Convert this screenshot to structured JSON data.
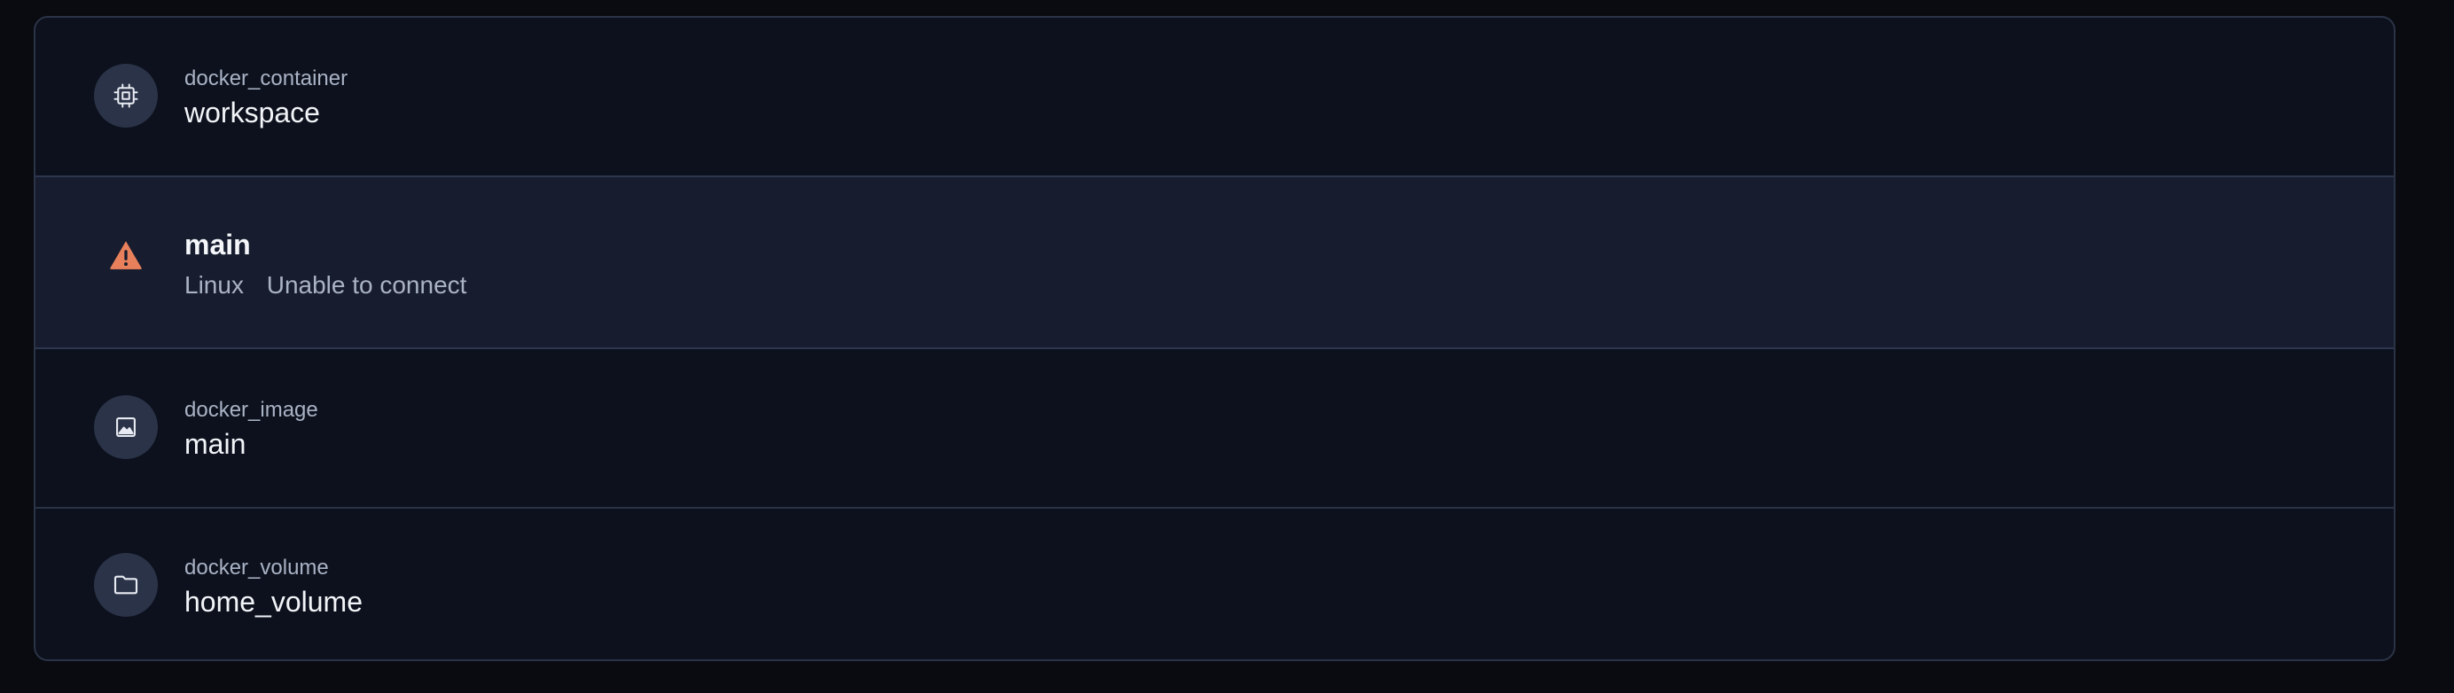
{
  "rows": [
    {
      "type_label": "docker_container",
      "name": "workspace",
      "icon": "cpu-icon"
    },
    {
      "name": "main",
      "os": "Linux",
      "status": "Unable to connect",
      "icon": "warning-icon",
      "status_color": "#e9805c"
    },
    {
      "type_label": "docker_image",
      "name": "main",
      "icon": "image-icon"
    },
    {
      "type_label": "docker_volume",
      "name": "home_volume",
      "icon": "folder-icon"
    }
  ]
}
